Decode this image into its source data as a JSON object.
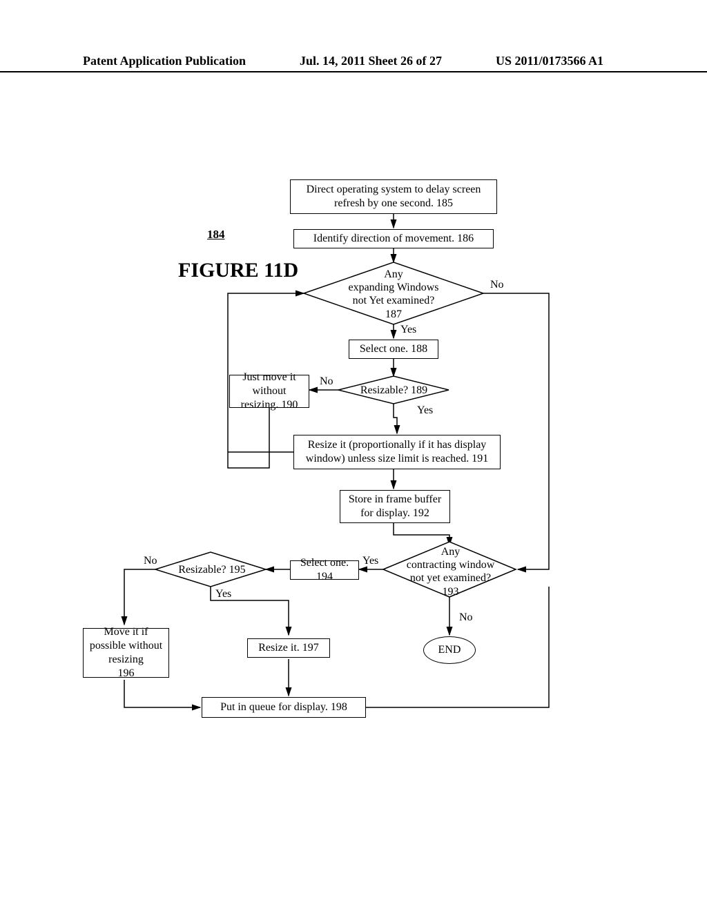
{
  "header": {
    "left": "Patent Application Publication",
    "mid": "Jul. 14, 2011  Sheet 26 of 27",
    "right": "US 2011/0173566 A1"
  },
  "figure": {
    "number": "184",
    "title": "FIGURE 11D"
  },
  "boxes": {
    "b185": "Direct operating system to delay screen refresh by one second.  185",
    "b186": "Identify direction of movement.  186",
    "b188": "Select one.  188",
    "b190": "Just move it without resizing.  190",
    "b191": "Resize it (proportionally if it has display window) unless size limit is reached.  191",
    "b192": "Store in frame buffer for display.  192",
    "b194": "Select one.  194",
    "b196": "Move it if possible without resizing\n196",
    "b197": "Resize it.  197",
    "b198": "Put in queue for display.  198"
  },
  "diamonds": {
    "d187": "Any\nexpanding Windows\nnot Yet examined?\n187",
    "d189": "Resizable?  189",
    "d193": "Any\ncontracting window\nnot yet examined?\n193",
    "d195": "Resizable?  195"
  },
  "labels": {
    "yes": "Yes",
    "no": "No",
    "end": "END"
  }
}
